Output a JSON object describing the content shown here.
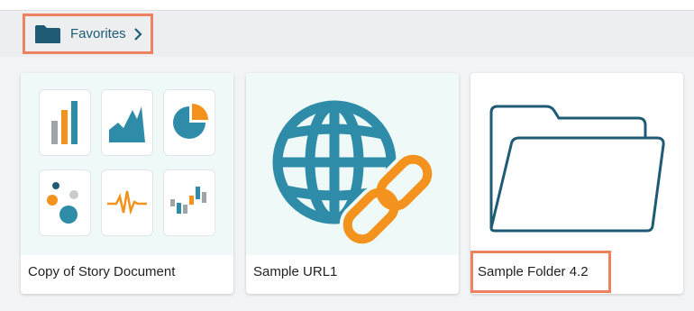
{
  "breadcrumb": {
    "label": "Favorites"
  },
  "cards": [
    {
      "title": "Copy of Story Document",
      "icon": "chart-collection-icon"
    },
    {
      "title": "Sample URL1",
      "icon": "globe-link-icon"
    },
    {
      "title": "Sample Folder 4.2",
      "icon": "folder-icon"
    }
  ],
  "colors": {
    "highlight": "#ee8260",
    "teal": "#2e8ca9",
    "orange": "#f3931d",
    "gray": "#9fa4a8",
    "folder_dark": "#1f5b74",
    "thumb_bg": "#effaf8"
  }
}
